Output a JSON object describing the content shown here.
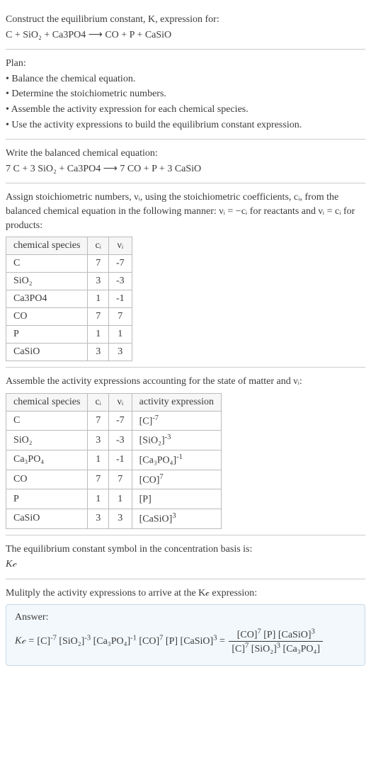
{
  "intro": {
    "line1": "Construct the equilibrium constant, K, expression for:",
    "line2": "C + SiO₂ + Ca3PO4 ⟶ CO + P + CaSiO"
  },
  "plan": {
    "heading": "Plan:",
    "bullets": [
      "• Balance the chemical equation.",
      "• Determine the stoichiometric numbers.",
      "• Assemble the activity expression for each chemical species.",
      "• Use the activity expressions to build the equilibrium constant expression."
    ]
  },
  "balanced": {
    "heading": "Write the balanced chemical equation:",
    "equation": "7 C + 3 SiO₂ + Ca3PO4 ⟶ 7 CO + P + 3 CaSiO"
  },
  "assign": {
    "text": "Assign stoichiometric numbers, νᵢ, using the stoichiometric coefficients, cᵢ, from the balanced chemical equation in the following manner: νᵢ = −cᵢ for reactants and νᵢ = cᵢ for products:",
    "headers": {
      "h1": "chemical species",
      "h2": "cᵢ",
      "h3": "νᵢ"
    },
    "rows": [
      {
        "sp": "C",
        "c": "7",
        "v": "-7"
      },
      {
        "sp": "SiO₂",
        "c": "3",
        "v": "-3"
      },
      {
        "sp": "Ca3PO4",
        "c": "1",
        "v": "-1"
      },
      {
        "sp": "CO",
        "c": "7",
        "v": "7"
      },
      {
        "sp": "P",
        "c": "1",
        "v": "1"
      },
      {
        "sp": "CaSiO",
        "c": "3",
        "v": "3"
      }
    ]
  },
  "activities": {
    "text": "Assemble the activity expressions accounting for the state of matter and νᵢ:",
    "headers": {
      "h1": "chemical species",
      "h2": "cᵢ",
      "h3": "νᵢ",
      "h4": "activity expression"
    },
    "rows": [
      {
        "sp": "C",
        "c": "7",
        "v": "-7",
        "ae_base": "[C]",
        "ae_exp": "-7"
      },
      {
        "sp": "SiO₂",
        "c": "3",
        "v": "-3",
        "ae_base": "[SiO₂]",
        "ae_exp": "-3"
      },
      {
        "sp": "Ca₃PO₄",
        "c": "1",
        "v": "-1",
        "ae_base": "[Ca₃PO₄]",
        "ae_exp": "-1"
      },
      {
        "sp": "CO",
        "c": "7",
        "v": "7",
        "ae_base": "[CO]",
        "ae_exp": "7"
      },
      {
        "sp": "P",
        "c": "1",
        "v": "1",
        "ae_base": "[P]",
        "ae_exp": ""
      },
      {
        "sp": "CaSiO",
        "c": "3",
        "v": "3",
        "ae_base": "[CaSiO]",
        "ae_exp": "3"
      }
    ]
  },
  "symbol": {
    "line1": "The equilibrium constant symbol in the concentration basis is:",
    "line2": "K𝒸"
  },
  "multiply": {
    "text": "Mulitply the activity expressions to arrive at the K𝒸 expression:"
  },
  "answer": {
    "label": "Answer:",
    "lhs": "K𝒸 = ",
    "terms": [
      {
        "base": "[C]",
        "exp": "-7"
      },
      {
        "base": "[SiO₂]",
        "exp": "-3"
      },
      {
        "base": "[Ca₃PO₄]",
        "exp": "-1"
      },
      {
        "base": "[CO]",
        "exp": "7"
      },
      {
        "base": "[P]",
        "exp": ""
      },
      {
        "base": "[CaSiO]",
        "exp": "3"
      }
    ],
    "eq": " = ",
    "frac_num": [
      {
        "base": "[CO]",
        "exp": "7"
      },
      {
        "base": "[P]",
        "exp": ""
      },
      {
        "base": "[CaSiO]",
        "exp": "3"
      }
    ],
    "frac_den": [
      {
        "base": "[C]",
        "exp": "7"
      },
      {
        "base": "[SiO₂]",
        "exp": "3"
      },
      {
        "base": "[Ca₃PO₄]",
        "exp": ""
      }
    ]
  },
  "chart_data": null
}
